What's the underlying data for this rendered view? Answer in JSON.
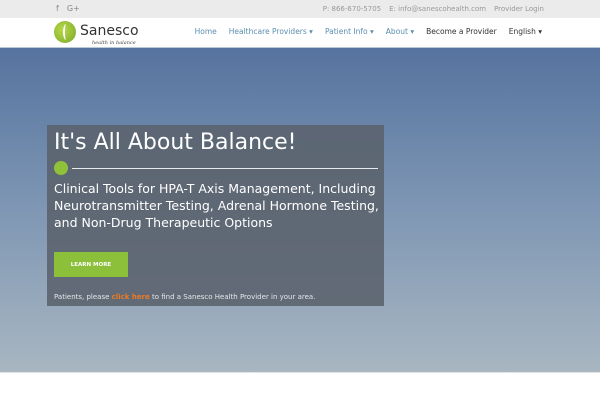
{
  "topbar": {
    "social": [
      "f",
      "G+"
    ],
    "phone": "P: 866-670-5705",
    "email": "E: info@sanescohealth.com",
    "provider_login": "Provider Login"
  },
  "logo": {
    "name": "Sanesco",
    "tagline": "health in balance"
  },
  "nav": {
    "items": [
      {
        "label": "Home"
      },
      {
        "label": "Healthcare Providers ▾"
      },
      {
        "label": "Patient Info ▾"
      },
      {
        "label": "About ▾"
      },
      {
        "label": "Become a Provider"
      },
      {
        "label": "English ▾"
      }
    ]
  },
  "hero": {
    "title": "It's All About Balance!",
    "subtitle": "Clinical Tools for HPA-T Axis Management, Including Neurotransmitter Testing, Adrenal Hormone Testing, and Non-Drug Therapeutic Options",
    "button": "LEARN MORE",
    "note_before": "Patients, please ",
    "note_link": "click here",
    "note_after": " to find a Sanesco Health Provider in your area."
  },
  "colors": {
    "accent": "#8cc03a",
    "link": "#f07a23",
    "nav_link": "#5b8fb0"
  }
}
